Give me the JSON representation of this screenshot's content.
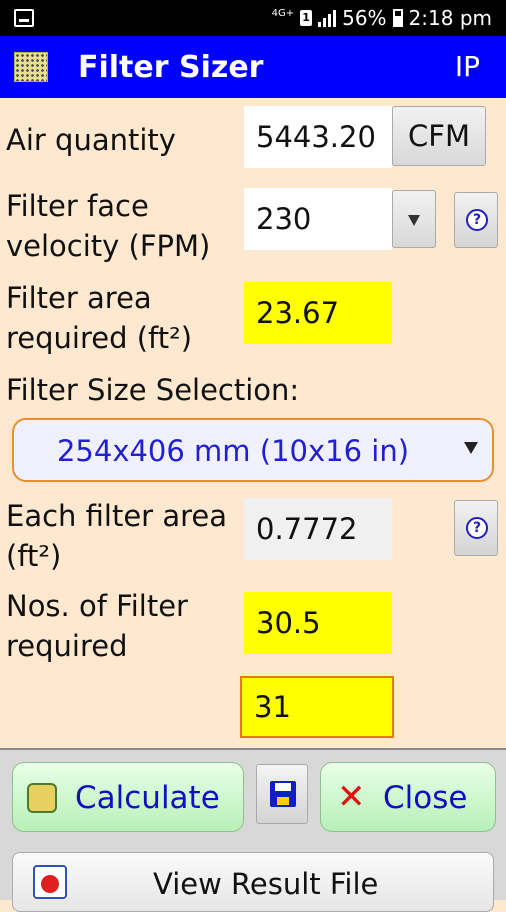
{
  "status": {
    "network": "4G+",
    "sim": "1",
    "battery": "56%",
    "time": "2:18 pm"
  },
  "app": {
    "title": "Filter Sizer",
    "units": "IP"
  },
  "form": {
    "air_quantity_label": "Air quantity",
    "air_quantity_value": "5443.20",
    "air_quantity_unit": "CFM",
    "face_velocity_label_1": "Filter face",
    "face_velocity_label_2": "velocity (FPM)",
    "face_velocity_value": "230",
    "area_required_label_1": "Filter area",
    "area_required_label_2": "required (ft²)",
    "area_required_value": "23.67",
    "size_selection_label": "Filter Size Selection:",
    "size_selection_value": "254x406 mm (10x16 in)",
    "each_area_label_1": "Each filter area",
    "each_area_label_2": "(ft²)",
    "each_area_value": "0.7772",
    "nos_label_1": "Nos. of Filter",
    "nos_label_2": "required",
    "nos_value": "30.5",
    "nos_rounded_value": "31"
  },
  "buttons": {
    "calculate": "Calculate",
    "close": "Close",
    "view_result": "View Result File"
  },
  "colors": {
    "appbar": "#0000FF",
    "background": "#FEE8D0",
    "result_highlight": "#FFFF00",
    "button_text": "#1010C0"
  }
}
